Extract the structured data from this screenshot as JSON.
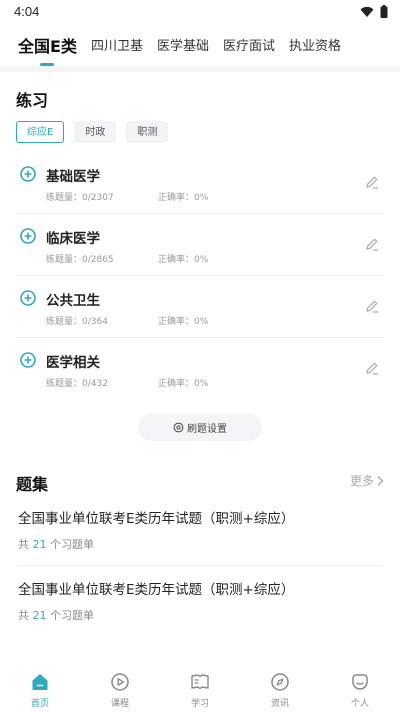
{
  "status_bar": {
    "time": "4:04"
  },
  "top_tabs": [
    {
      "label": "全国E类",
      "active": true
    },
    {
      "label": "四川卫基",
      "active": false
    },
    {
      "label": "医学基础",
      "active": false
    },
    {
      "label": "医疗面试",
      "active": false
    },
    {
      "label": "执业资格",
      "active": false
    }
  ],
  "practice": {
    "title": "练习",
    "chips": [
      {
        "label": "综应E",
        "active": true
      },
      {
        "label": "时政",
        "active": false
      },
      {
        "label": "职测",
        "active": false
      }
    ],
    "items": [
      {
        "title": "基础医学",
        "count": "练题量：0/2307",
        "rate": "正确率：0%"
      },
      {
        "title": "临床医学",
        "count": "练题量：0/2865",
        "rate": "正确率：0%"
      },
      {
        "title": "公共卫生",
        "count": "练题量：0/364",
        "rate": "正确率：0%"
      },
      {
        "title": "医学相关",
        "count": "练题量：0/432",
        "rate": "正确率：0%"
      }
    ],
    "settings_label": "刷题设置"
  },
  "collections": {
    "title": "题集",
    "more_label": "更多",
    "items": [
      {
        "title": "全国事业单位联考E类历年试题（职测+综应）",
        "prefix": "共",
        "count": "21",
        "suffix": "个习题单"
      },
      {
        "title": "全国事业单位联考E类历年试题（职测+综应）",
        "prefix": "共",
        "count": "21",
        "suffix": "个习题单"
      }
    ]
  },
  "bottom_nav": [
    {
      "label": "首页",
      "icon": "home-icon",
      "active": true
    },
    {
      "label": "课程",
      "icon": "play-circle-icon",
      "active": false
    },
    {
      "label": "学习",
      "icon": "book-icon",
      "active": false
    },
    {
      "label": "资讯",
      "icon": "compass-icon",
      "active": false
    },
    {
      "label": "个人",
      "icon": "profile-icon",
      "active": false
    }
  ],
  "colors": {
    "accent": "#2fa8c2",
    "text": "#222222",
    "muted": "#999999",
    "band": "#f4f5f7"
  }
}
